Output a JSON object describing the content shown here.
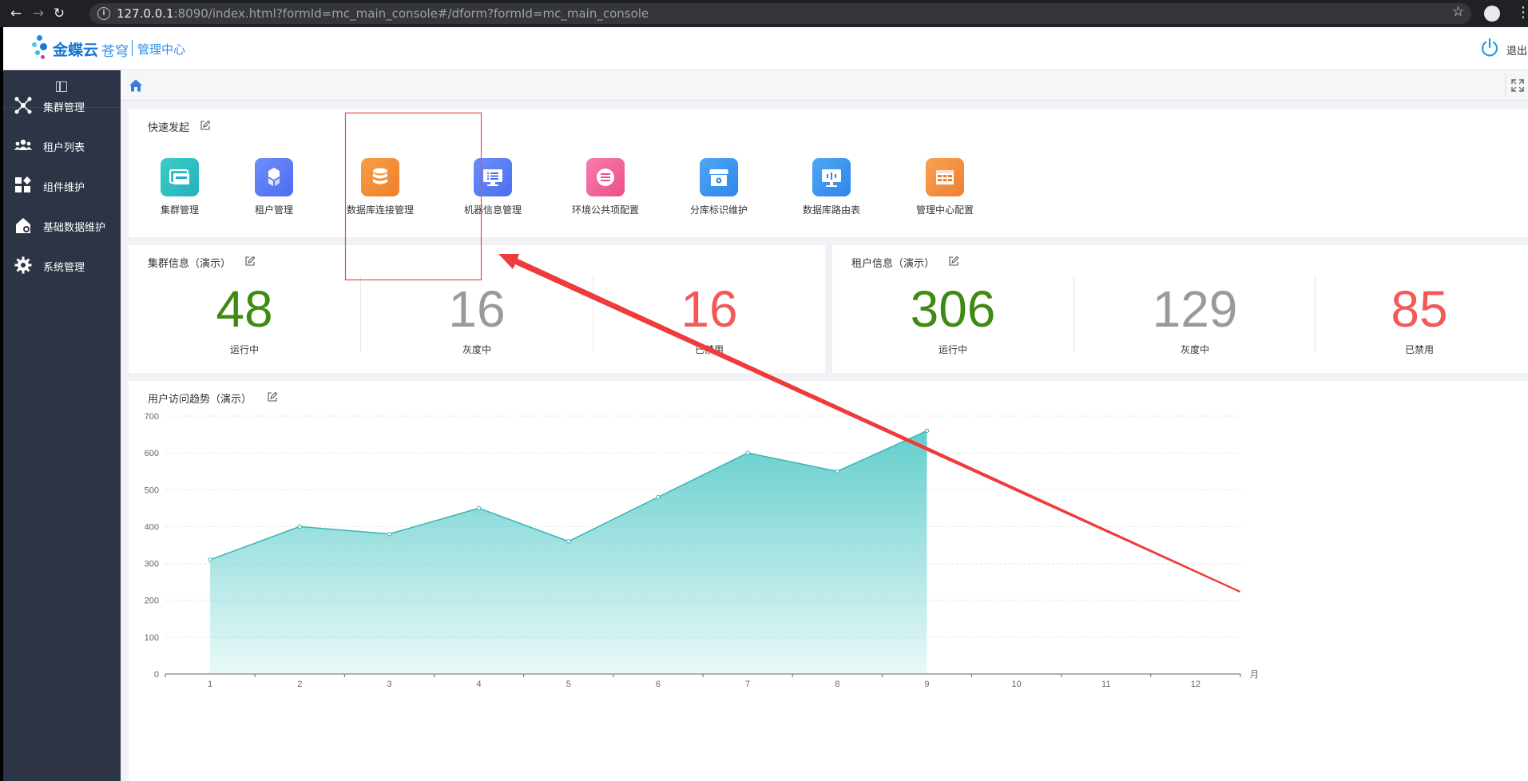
{
  "browser": {
    "url_host": "127.0.0.1",
    "url_rest": ":8090/index.html?formId=mc_main_console#/dform?formId=mc_main_console"
  },
  "header": {
    "brand": "金蝶云",
    "brand_sub": "苍穹",
    "admin_label": "管理中心",
    "logout_label": "退出"
  },
  "sidebar": {
    "items": [
      {
        "label": "集群管理",
        "icon": "cluster-icon"
      },
      {
        "label": "租户列表",
        "icon": "users-icon"
      },
      {
        "label": "组件维护",
        "icon": "components-icon"
      },
      {
        "label": "基础数据维护",
        "icon": "data-maintain-icon"
      },
      {
        "label": "系统管理",
        "icon": "gear-icon"
      }
    ]
  },
  "quick_start": {
    "title": "快速发起",
    "items": [
      {
        "label": "集群管理",
        "color_from": "#3ecdc7",
        "color_to": "#23b1bd"
      },
      {
        "label": "租户管理",
        "color_from": "#6f8dfb",
        "color_to": "#4d6cf0"
      },
      {
        "label": "数据库连接管理",
        "color_from": "#f5a04a",
        "color_to": "#ef7e2a"
      },
      {
        "label": "机器信息管理",
        "color_from": "#6b8ff7",
        "color_to": "#4c6ef0"
      },
      {
        "label": "环境公共项配置",
        "color_from": "#f77cae",
        "color_to": "#ec4f8a"
      },
      {
        "label": "分库标识维护",
        "color_from": "#4fa6f5",
        "color_to": "#2f86e8"
      },
      {
        "label": "数据库路由表",
        "color_from": "#4fa6f5",
        "color_to": "#2f86e8"
      },
      {
        "label": "管理中心配置",
        "color_from": "#f8a251",
        "color_to": "#ef7f31"
      }
    ]
  },
  "cluster_info": {
    "title": "集群信息（演示）",
    "stats": [
      {
        "value": "48",
        "label": "运行中",
        "color": "#3f8a12"
      },
      {
        "value": "16",
        "label": "灰度中",
        "color": "#9a9a9a"
      },
      {
        "value": "16",
        "label": "已禁用",
        "color": "#f25a5a"
      }
    ]
  },
  "tenant_info": {
    "title": "租户信息（演示）",
    "stats": [
      {
        "value": "306",
        "label": "运行中",
        "color": "#3f8a12"
      },
      {
        "value": "129",
        "label": "灰度中",
        "color": "#9a9a9a"
      },
      {
        "value": "85",
        "label": "已禁用",
        "color": "#f25a5a"
      }
    ]
  },
  "trend": {
    "title": "用户访问趋势（演示）"
  },
  "chart_data": {
    "type": "area",
    "x": [
      "1",
      "2",
      "3",
      "4",
      "5",
      "6",
      "7",
      "8",
      "9",
      "10",
      "11",
      "12"
    ],
    "values": [
      310,
      400,
      380,
      450,
      360,
      480,
      600,
      550,
      660
    ],
    "xlabel": "月",
    "ylabel": "",
    "ylim": [
      0,
      700
    ],
    "yticks": [
      "0",
      "100",
      "200",
      "300",
      "400",
      "500",
      "600",
      "700"
    ],
    "grid": true,
    "color": "#48c6c4"
  }
}
